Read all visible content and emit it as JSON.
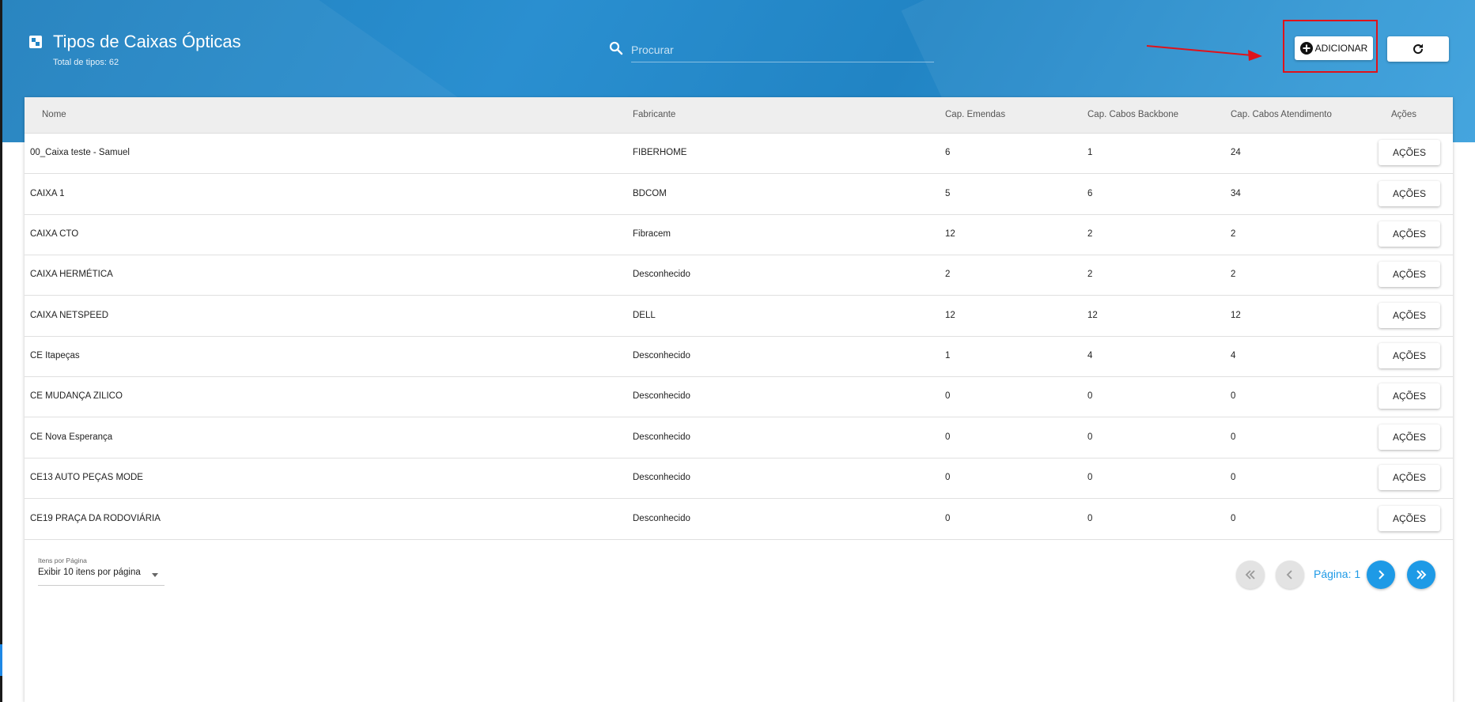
{
  "header": {
    "title": "Tipos de Caixas Ópticas",
    "subtitle": "Total de tipos: 62",
    "search_placeholder": "Procurar",
    "add_label": "ADICIONAR"
  },
  "table": {
    "columns": [
      "Nome",
      "Fabricante",
      "Cap. Emendas",
      "Cap. Cabos Backbone",
      "Cap. Cabos Atendimento",
      "Ações"
    ],
    "action_label": "AÇÕES",
    "rows": [
      {
        "nome": "00_Caixa teste - Samuel",
        "fabricante": "FIBERHOME",
        "emendas": "6",
        "backbone": "1",
        "atendimento": "24"
      },
      {
        "nome": "CAIXA 1",
        "fabricante": "BDCOM",
        "emendas": "5",
        "backbone": "6",
        "atendimento": "34"
      },
      {
        "nome": "CAIXA CTO",
        "fabricante": "Fibracem",
        "emendas": "12",
        "backbone": "2",
        "atendimento": "2"
      },
      {
        "nome": "CAIXA HERMÉTICA",
        "fabricante": "Desconhecido",
        "emendas": "2",
        "backbone": "2",
        "atendimento": "2"
      },
      {
        "nome": "CAIXA NETSPEED",
        "fabricante": "DELL",
        "emendas": "12",
        "backbone": "12",
        "atendimento": "12"
      },
      {
        "nome": "CE Itapeças",
        "fabricante": "Desconhecido",
        "emendas": "1",
        "backbone": "4",
        "atendimento": "4"
      },
      {
        "nome": "CE MUDANÇA ZILICO",
        "fabricante": "Desconhecido",
        "emendas": "0",
        "backbone": "0",
        "atendimento": "0"
      },
      {
        "nome": "CE Nova Esperança",
        "fabricante": "Desconhecido",
        "emendas": "0",
        "backbone": "0",
        "atendimento": "0"
      },
      {
        "nome": "CE13 AUTO PEÇAS MODE",
        "fabricante": "Desconhecido",
        "emendas": "0",
        "backbone": "0",
        "atendimento": "0"
      },
      {
        "nome": "CE19 PRAÇA DA RODOVIÁRIA",
        "fabricante": "Desconhecido",
        "emendas": "0",
        "backbone": "0",
        "atendimento": "0"
      }
    ]
  },
  "footer": {
    "per_page_label": "Itens por Página",
    "per_page_value": "Exibir 10 itens por página",
    "page_label": "Página: 1"
  },
  "icons": {
    "title": "box-icon",
    "search": "search-icon",
    "add": "plus-circle-icon",
    "refresh": "refresh-icon",
    "first": "double-chevron-left-icon",
    "prev": "chevron-left-icon",
    "next": "chevron-right-icon",
    "last": "double-chevron-right-icon"
  },
  "colors": {
    "header_blue": "#2184c4",
    "accent": "#1e9ae6",
    "highlight": "#e0121a"
  }
}
